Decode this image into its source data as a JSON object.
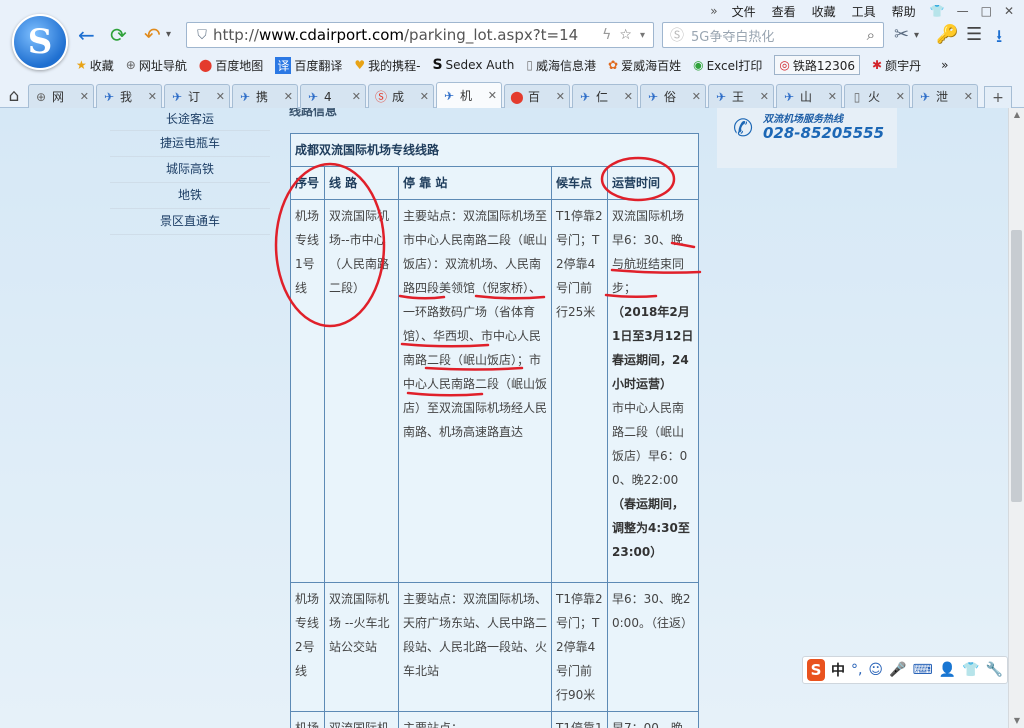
{
  "browser": {
    "menu": [
      "文件",
      "查看",
      "收藏",
      "工具",
      "帮助"
    ],
    "url_prefix": "http://",
    "url_host": "www.cdairport.com",
    "url_path": "/parking_lot.aspx?t=14",
    "search_placeholder": "5G争夺白热化",
    "bookmarks": [
      {
        "icon": "star-icon",
        "label": "收藏"
      },
      {
        "icon": "globe-icon",
        "label": "网址导航"
      },
      {
        "icon": "map-pin-icon",
        "label": "百度地图"
      },
      {
        "icon": "translate-icon",
        "label": "百度翻译"
      },
      {
        "icon": "heart-icon",
        "label": "我的携程-"
      },
      {
        "icon": "sedex-icon",
        "label": "Sedex Auth"
      },
      {
        "icon": "doc-icon",
        "label": "威海信息港"
      },
      {
        "icon": "shop-icon",
        "label": "爱威海百姓"
      },
      {
        "icon": "print-icon",
        "label": "Excel打印"
      },
      {
        "icon": "train-icon",
        "label": "铁路12306"
      },
      {
        "icon": "profile-icon",
        "label": "颜宇丹"
      }
    ],
    "tabs": [
      {
        "icon": "globe-icon",
        "label": "网"
      },
      {
        "icon": "bird-icon",
        "label": "我"
      },
      {
        "icon": "bird-icon",
        "label": "订"
      },
      {
        "icon": "bird-icon",
        "label": "携"
      },
      {
        "icon": "bird-icon",
        "label": "4"
      },
      {
        "icon": "s-icon",
        "label": "成"
      },
      {
        "icon": "plane-icon",
        "label": "机"
      },
      {
        "icon": "map-pin-icon",
        "label": "百"
      },
      {
        "icon": "bird-icon",
        "label": "仁"
      },
      {
        "icon": "bird-icon",
        "label": "俗"
      },
      {
        "icon": "bird-icon",
        "label": "王"
      },
      {
        "icon": "bird-icon",
        "label": "山"
      },
      {
        "icon": "doc-icon",
        "label": "火"
      },
      {
        "icon": "bird-icon",
        "label": "泄"
      }
    ],
    "active_tab_index": 6
  },
  "sidebar": {
    "items": [
      "长途客运",
      "捷运电瓶车",
      "城际高铁",
      "地铁",
      "景区直通车"
    ]
  },
  "section_label": "线路信息",
  "hotline": {
    "title": "双流机场服务热线",
    "number": "028-85205555"
  },
  "routes": {
    "caption": "成都双流国际机场专线线路",
    "headers": [
      "序号",
      "线 路",
      "停 靠 站",
      "候车点",
      "运营时间"
    ],
    "rows": [
      {
        "no": "机场专线1号线",
        "route": "双流国际机场--市中心（人民南路二段）",
        "stops": "主要站点：双流国际机场至市中心人民南路二段（岷山饭店）：双流机场、人民南路四段美领馆（倪家桥）、一环路数码广场（省体育馆）、华西坝、市中心人民南路二段（岷山饭店）；市中心人民南路二段（岷山饭店）至双流国际机场经人民南路、机场高速路直达",
        "waiting": "T1停靠2号门；T2停靠4号门前行25米",
        "hours_1": "双流国际机场早6：30、晚与航班结束同步；",
        "hours_bold_1": "（2018年2月1日至3月12日春运期间，24小时运营）",
        "hours_2": "市中心人民南路二段（岷山饭店）早6：00、晚22:00",
        "hours_bold_2": "（春运期间，调整为4:30至23:00）"
      },
      {
        "no": "机场专线2号线",
        "route": "双流国际机场 --火车北站公交站",
        "stops": "主要站点：双流国际机场、天府广场东站、人民中路二段站、人民北路一段站、火车北站",
        "waiting": "T1停靠2号门；T2停靠4号门前行90米",
        "hours_1": "早6：30、晚20:00。（往返）"
      },
      {
        "no": "机场",
        "route": "双流国际机",
        "stops": "主要站点：",
        "waiting": "T1停靠1",
        "hours_1": "早7：00、晚"
      }
    ]
  },
  "ime": {
    "logo": "S",
    "mode": "中",
    "punct": "°,"
  }
}
